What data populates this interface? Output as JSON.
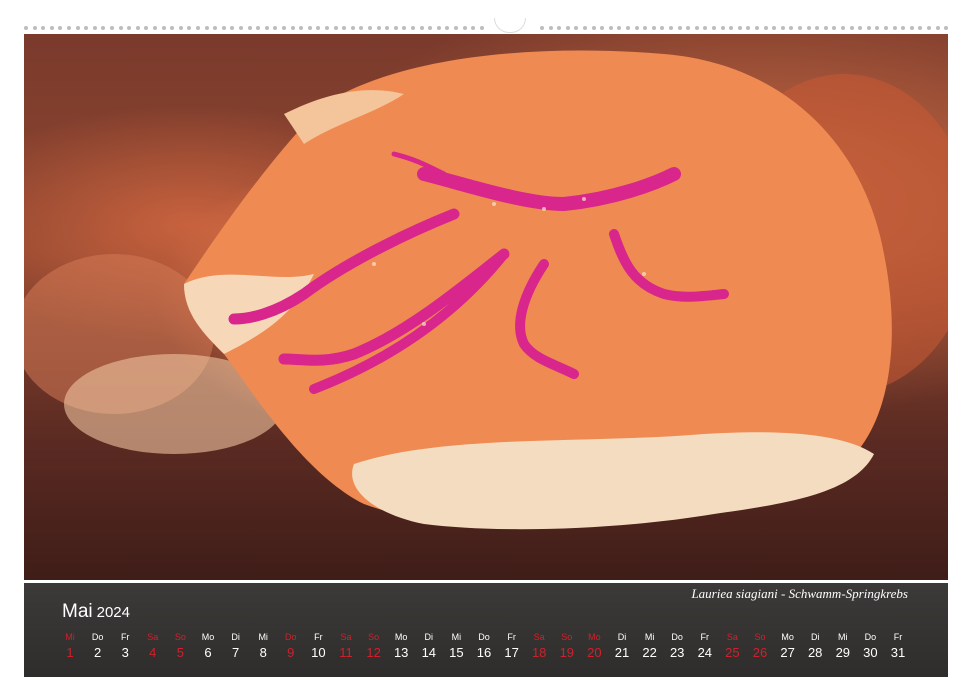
{
  "photo": {
    "caption": "Lauriea siagiani - Schwamm-Springkrebs",
    "subject": "hairy squat lobster on orange sponge"
  },
  "calendar": {
    "month": "Mai",
    "year": "2024",
    "days": [
      {
        "wd": "Mi",
        "d": "1",
        "red": true
      },
      {
        "wd": "Do",
        "d": "2",
        "red": false
      },
      {
        "wd": "Fr",
        "d": "3",
        "red": false
      },
      {
        "wd": "Sa",
        "d": "4",
        "red": true
      },
      {
        "wd": "So",
        "d": "5",
        "red": true
      },
      {
        "wd": "Mo",
        "d": "6",
        "red": false
      },
      {
        "wd": "Di",
        "d": "7",
        "red": false
      },
      {
        "wd": "Mi",
        "d": "8",
        "red": false
      },
      {
        "wd": "Do",
        "d": "9",
        "red": true
      },
      {
        "wd": "Fr",
        "d": "10",
        "red": false
      },
      {
        "wd": "Sa",
        "d": "11",
        "red": true
      },
      {
        "wd": "So",
        "d": "12",
        "red": true
      },
      {
        "wd": "Mo",
        "d": "13",
        "red": false
      },
      {
        "wd": "Di",
        "d": "14",
        "red": false
      },
      {
        "wd": "Mi",
        "d": "15",
        "red": false
      },
      {
        "wd": "Do",
        "d": "16",
        "red": false
      },
      {
        "wd": "Fr",
        "d": "17",
        "red": false
      },
      {
        "wd": "Sa",
        "d": "18",
        "red": true
      },
      {
        "wd": "So",
        "d": "19",
        "red": true
      },
      {
        "wd": "Mo",
        "d": "20",
        "red": true
      },
      {
        "wd": "Di",
        "d": "21",
        "red": false
      },
      {
        "wd": "Mi",
        "d": "22",
        "red": false
      },
      {
        "wd": "Do",
        "d": "23",
        "red": false
      },
      {
        "wd": "Fr",
        "d": "24",
        "red": false
      },
      {
        "wd": "Sa",
        "d": "25",
        "red": true
      },
      {
        "wd": "So",
        "d": "26",
        "red": true
      },
      {
        "wd": "Mo",
        "d": "27",
        "red": false
      },
      {
        "wd": "Di",
        "d": "28",
        "red": false
      },
      {
        "wd": "Mi",
        "d": "29",
        "red": false
      },
      {
        "wd": "Do",
        "d": "30",
        "red": false
      },
      {
        "wd": "Fr",
        "d": "31",
        "red": false
      }
    ]
  },
  "colors": {
    "weekend": "#d0202a",
    "strip": "#333130",
    "text": "#ffffff"
  }
}
